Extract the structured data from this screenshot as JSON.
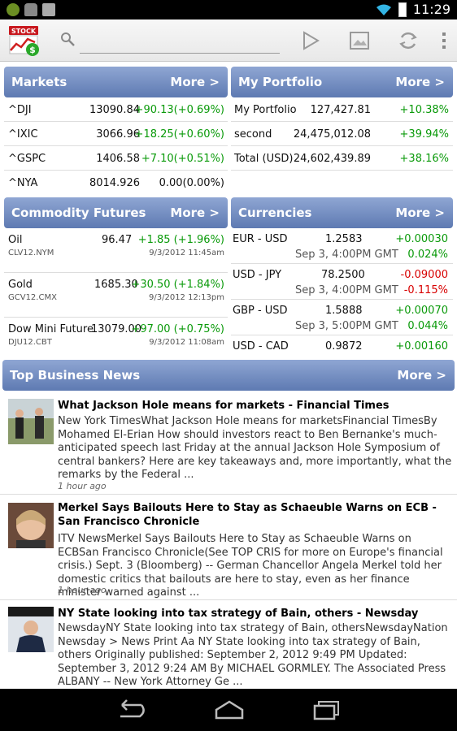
{
  "status_bar": {
    "time": "11:29"
  },
  "toolbar": {
    "app_name": "STOCK",
    "search_placeholder": ""
  },
  "markets": {
    "title": "Markets",
    "more": "More >",
    "rows": [
      {
        "symbol": "^DJI",
        "value": "13090.84",
        "change": "+90.13(+0.69%)"
      },
      {
        "symbol": "^IXIC",
        "value": "3066.96",
        "change": "+18.25(+0.60%)"
      },
      {
        "symbol": "^GSPC",
        "value": "1406.58",
        "change": "+7.10(+0.51%)"
      },
      {
        "symbol": "^NYA",
        "value": "8014.926",
        "change": "0.00(0.00%)"
      }
    ]
  },
  "portfolio": {
    "title": "My Portfolio",
    "more": "More >",
    "rows": [
      {
        "name": "My Portfolio",
        "value": "127,427.81",
        "change": "+10.38%"
      },
      {
        "name": "second",
        "value": "24,475,012.08",
        "change": "+39.94%"
      },
      {
        "name": "Total (USD)",
        "value": "24,602,439.89",
        "change": "+38.16%"
      }
    ]
  },
  "commodities": {
    "title": "Commodity Futures",
    "more": "More >",
    "rows": [
      {
        "name": "Oil",
        "symbol": "CLV12.NYM",
        "price": "96.47",
        "change": "+1.85 (+1.96%)",
        "time": "9/3/2012 11:45am"
      },
      {
        "name": "Gold",
        "symbol": "GCV12.CMX",
        "price": "1685.30",
        "change": "+30.50 (+1.84%)",
        "time": "9/3/2012 12:13pm"
      },
      {
        "name": "Dow Mini Future",
        "symbol": "DJU12.CBT",
        "price": "13079.00",
        "change": "+97.00 (+0.75%)",
        "time": "9/3/2012 11:08am"
      }
    ]
  },
  "currencies": {
    "title": "Currencies",
    "more": "More >",
    "rows": [
      {
        "pair": "EUR - USD",
        "rate": "1.2583",
        "change": "+0.00030",
        "time": "Sep 3, 4:00PM GMT",
        "pct": "0.024%"
      },
      {
        "pair": "USD - JPY",
        "rate": "78.2500",
        "change": "-0.09000",
        "time": "Sep 3, 4:00PM GMT",
        "pct": "-0.115%"
      },
      {
        "pair": "GBP - USD",
        "rate": "1.5888",
        "change": "+0.00070",
        "time": "Sep 3, 5:00PM GMT",
        "pct": "0.044%"
      },
      {
        "pair": "USD - CAD",
        "rate": "0.9872",
        "change": "+0.00160"
      }
    ]
  },
  "news": {
    "title": "Top Business News",
    "more": "More >",
    "items": [
      {
        "title": "What Jackson Hole means for markets - Financial Times",
        "body": "New York TimesWhat Jackson Hole means for marketsFinancial TimesBy Mohamed El-Erian How should investors react to Ben Bernanke's much-anticipated speech last Friday at the annual Jackson Hole Symposium of central bankers? Here are key takeaways and, more importantly, what the remarks by the Federal  ...",
        "time": "1 hour ago"
      },
      {
        "title": "Merkel Says Bailouts Here to Stay as Schaeuble Warns on ECB - San Francisco Chronicle",
        "body": "ITV NewsMerkel Says Bailouts Here to Stay as Schaeuble Warns on ECBSan Francisco Chronicle(See TOP CRIS for more on Europe's financial crisis.) Sept. 3 (Bloomberg) -- German Chancellor Angela Merkel told her domestic critics that bailouts are here to stay, even as her finance minister warned against ...",
        "time": "1 hour ago"
      },
      {
        "title": "NY State looking into tax strategy of Bain, others - Newsday",
        "body": "NewsdayNY State looking into tax strategy of Bain, othersNewsdayNation Newsday > News Print Aa NY State looking into tax strategy of Bain, others Originally published: September 2, 2012 9:49 PM Updated: September 3, 2012 9:24 AM By MICHAEL GORMLEY. The Associated Press ALBANY -- New York Attorney Ge ..."
      }
    ]
  },
  "colors": {
    "header": "#6f88c0",
    "positive": "#0a9a0a",
    "negative": "#d80000"
  }
}
